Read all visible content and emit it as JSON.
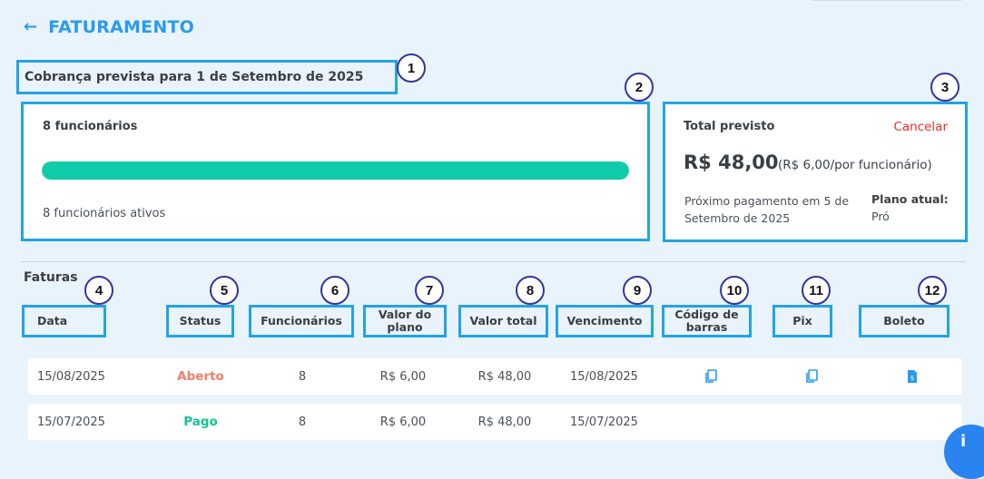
{
  "header": {
    "back_icon": "arrow-left-icon",
    "title": "FATURAMENTO"
  },
  "billing": {
    "heading": "Cobrança prevista para 1 de Setembro de 2025"
  },
  "employees_card": {
    "label": "8 funcionários",
    "progress": 1.0,
    "active_text": "8 funcionários ativos"
  },
  "total_card": {
    "label": "Total previsto",
    "cancel": "Cancelar",
    "amount": "R$ 48,00",
    "per_employee": "(R$ 6,00/por funcionário)",
    "next_payment": "Próximo pagamento em 5 de Setembro de 2025",
    "plan_label": "Plano atual:",
    "plan_value": "Pró"
  },
  "invoices": {
    "title": "Faturas",
    "columns": [
      "Data",
      "Status",
      "Funcionários",
      "Valor do plano",
      "Valor total",
      "Vencimento",
      "Código de barras",
      "Pix",
      "Boleto"
    ],
    "rows": [
      {
        "date": "15/08/2025",
        "status": "Aberto",
        "employees": "8",
        "plan_value": "R$ 6,00",
        "total": "R$ 48,00",
        "due": "15/08/2025",
        "barcode_icon": "copy-icon",
        "pix_icon": "copy-icon",
        "boleto_icon": "document-dollar-icon"
      },
      {
        "date": "15/07/2025",
        "status": "Pago",
        "employees": "8",
        "plan_value": "R$ 6,00",
        "total": "R$ 48,00",
        "due": "15/07/2025"
      }
    ]
  },
  "annotations": [
    "1",
    "2",
    "3",
    "4",
    "5",
    "6",
    "7",
    "8",
    "9",
    "10",
    "11",
    "12"
  ],
  "colors": {
    "accent": "#2a9bf0",
    "progress": "#0fcca8",
    "cancel": "#f02a2a",
    "status_open": "#f37d69",
    "status_paid": "#10c48f",
    "highlight_border": "#23a3e6",
    "badge_border": "#35359c"
  }
}
